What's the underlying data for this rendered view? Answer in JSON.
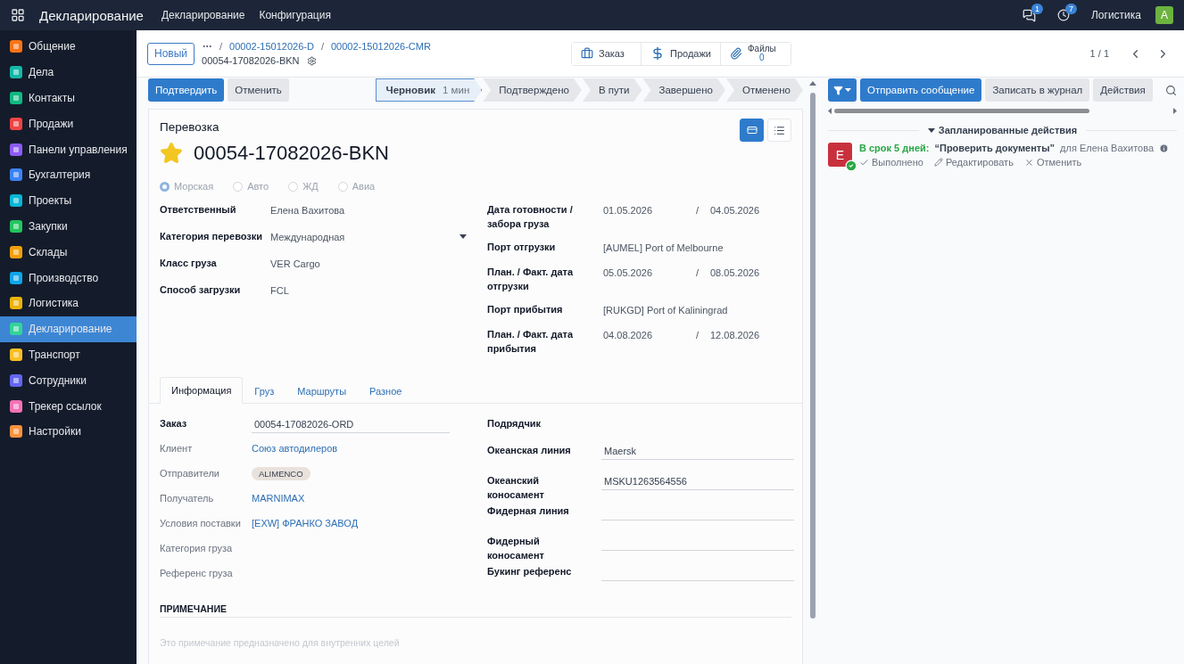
{
  "topbar": {
    "app_title": "Декларирование",
    "menu": [
      "Декларирование",
      "Конфигурация"
    ],
    "messages_badge": "1",
    "activities_badge": "7",
    "company": "Логистика",
    "avatar": "A"
  },
  "sidebar": {
    "items": [
      {
        "label": "Общение",
        "selected": false
      },
      {
        "label": "Дела",
        "selected": false
      },
      {
        "label": "Контакты",
        "selected": false
      },
      {
        "label": "Продажи",
        "selected": false
      },
      {
        "label": "Панели управления",
        "selected": false
      },
      {
        "label": "Бухгалтерия",
        "selected": false
      },
      {
        "label": "Проекты",
        "selected": false
      },
      {
        "label": "Закупки",
        "selected": false
      },
      {
        "label": "Склады",
        "selected": false
      },
      {
        "label": "Производство",
        "selected": false
      },
      {
        "label": "Логистика",
        "selected": false
      },
      {
        "label": "Декларирование",
        "selected": true
      },
      {
        "label": "Транспорт",
        "selected": false
      },
      {
        "label": "Сотрудники",
        "selected": false
      },
      {
        "label": "Трекер ссылок",
        "selected": false
      },
      {
        "label": "Настройки",
        "selected": false
      }
    ]
  },
  "control_panel": {
    "new_button": "Новый",
    "breadcrumbs": [
      "00002-15012026-D",
      "00002-15012026-CMR"
    ],
    "separator": "/",
    "current": "00054-17082026-BKN",
    "smart_buttons": [
      {
        "kind": "order",
        "label": "Заказ"
      },
      {
        "kind": "sales",
        "label": "Продажи"
      },
      {
        "kind": "files",
        "label": "Файлы",
        "count": "0"
      }
    ],
    "pager": "1 / 1"
  },
  "actions": [
    {
      "kind": "primary",
      "label": "Подтвердить"
    },
    {
      "kind": "secondary",
      "label": "Отменить"
    }
  ],
  "statusbar": [
    {
      "label": "Черновик",
      "duration": "1 мин",
      "selected": true
    },
    {
      "label": "Подтверждено",
      "selected": false
    },
    {
      "label": "В пути",
      "selected": false
    },
    {
      "label": "Завершено",
      "selected": false
    },
    {
      "label": "Отменено",
      "selected": false
    }
  ],
  "sheet": {
    "title": "Перевозка",
    "starred": true,
    "name": "00054-17082026-BKN",
    "views": [
      {
        "kind": "card",
        "selected": true
      },
      {
        "kind": "list",
        "selected": false
      }
    ],
    "modes": [
      {
        "label": "Морская",
        "selected": true
      },
      {
        "label": "Авто",
        "selected": false
      },
      {
        "label": "ЖД",
        "selected": false
      },
      {
        "label": "Авиа",
        "selected": false
      }
    ],
    "left_fields": [
      {
        "label": "Ответственный",
        "kind": "text",
        "value": "Елена Вахитова"
      },
      {
        "label": "Категория перевозки",
        "kind": "select",
        "value": "Международная"
      },
      {
        "label": "Класс груза",
        "kind": "text",
        "value": "VER Cargo"
      },
      {
        "label": "Способ загрузки",
        "kind": "text",
        "value": "FCL"
      }
    ],
    "right_fields": [
      {
        "label": "Дата готовности / забора груза",
        "kind": "range",
        "from": "01.05.2026",
        "separator": "/",
        "to": "04.05.2026"
      },
      {
        "label": "Порт отгрузки",
        "kind": "text",
        "value": "[AUMEL] Port of Melbourne"
      },
      {
        "label": "План. / Факт. дата отгрузки",
        "kind": "range",
        "from": "05.05.2026",
        "separator": "/",
        "to": "08.05.2026"
      },
      {
        "label": "Порт прибытия",
        "kind": "text",
        "value": "[RUKGD] Port of Kaliningrad"
      },
      {
        "label": "План. / Факт. дата прибытия",
        "kind": "range",
        "from": "04.08.2026",
        "separator": "/",
        "to": "12.08.2026"
      }
    ],
    "tabs": [
      {
        "label": "Информация",
        "selected": true
      },
      {
        "label": "Груз",
        "selected": false
      },
      {
        "label": "Маршруты",
        "selected": false
      },
      {
        "label": "Разное",
        "selected": false
      }
    ],
    "info_left": [
      {
        "label": "Заказ",
        "required": true,
        "kind": "field",
        "value": "00054-17082026-ORD"
      },
      {
        "label": "Клиент",
        "required": false,
        "kind": "link",
        "value": "Союз автодилеров"
      },
      {
        "label": "Отправители",
        "required": false,
        "kind": "tag",
        "value": "ALIMENCO"
      },
      {
        "label": "Получатель",
        "required": false,
        "kind": "link",
        "value": "MARNIMAX"
      },
      {
        "label": "Условия поставки",
        "required": false,
        "kind": "link",
        "value": "[EXW] ФРАНКО ЗАВОД"
      },
      {
        "label": "Категория груза",
        "required": false,
        "kind": "text"
      },
      {
        "label": "Референс груза",
        "required": false,
        "kind": "text"
      }
    ],
    "info_right": [
      {
        "label": "Подрядчик",
        "kind": "text"
      },
      {
        "label": "Океанская линия",
        "kind": "field",
        "value": "Maersk"
      },
      {
        "label": "Океанский коносамент",
        "kind": "field",
        "value": "MSKU1263564556"
      },
      {
        "label": "Фидерная линия",
        "kind": "field"
      },
      {
        "label": "Фидерный коносамент",
        "kind": "field"
      },
      {
        "label": "Букинг референс",
        "kind": "field"
      }
    ],
    "note_heading": "ПРИМЕЧАНИЕ",
    "note_placeholder": "Это примечание предназначено для внутренних целей"
  },
  "chatter": {
    "buttons": [
      {
        "kind": "primary",
        "label": "Отправить сообщение"
      },
      {
        "kind": "secondary",
        "label": "Записать в журнал"
      },
      {
        "kind": "secondary",
        "label": "Действия"
      }
    ],
    "section": "Запланированные действия",
    "activity": {
      "avatar": "E",
      "due": "В срок 5 дней:",
      "summary": "“Проверить документы”",
      "assignee": "для Елена Вахитова",
      "actions": [
        {
          "kind": "done",
          "label": "Выполнено"
        },
        {
          "kind": "edit",
          "label": "Редактировать"
        },
        {
          "kind": "cancel",
          "label": "Отменить"
        }
      ]
    }
  }
}
